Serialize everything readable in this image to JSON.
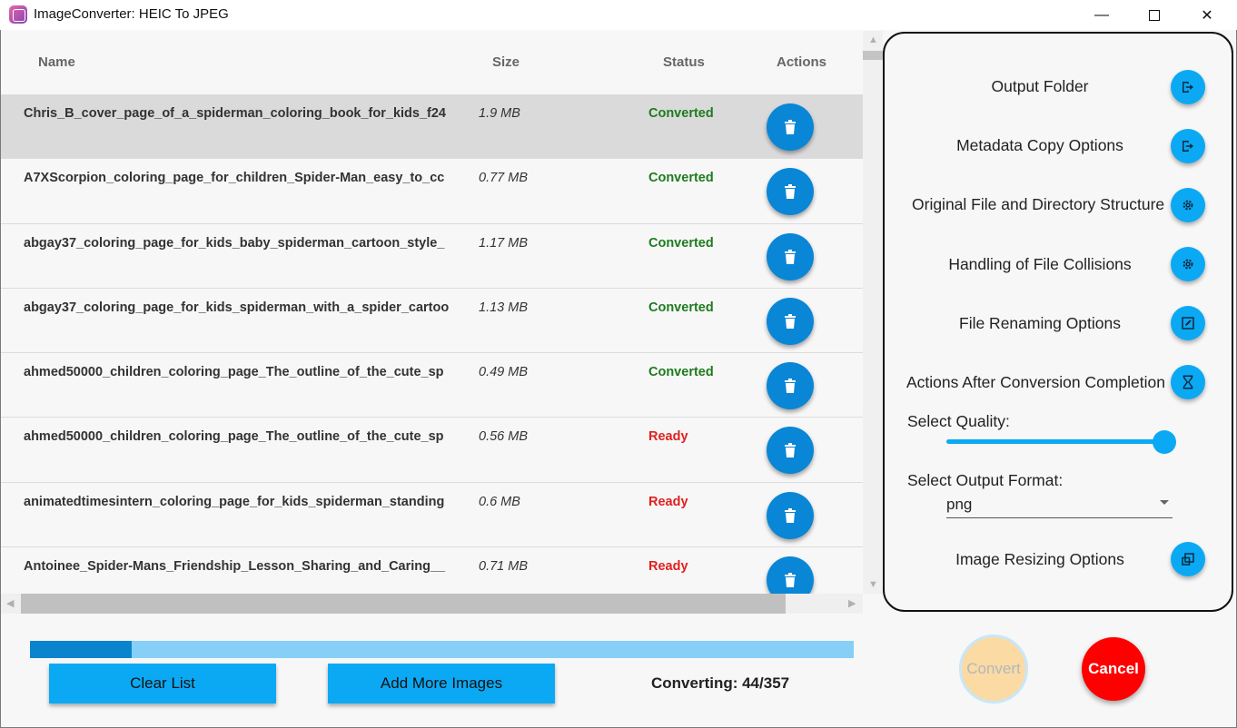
{
  "window": {
    "title": "ImageConverter: HEIC To JPEG",
    "minimize": "—",
    "close": "✕"
  },
  "table": {
    "headers": {
      "name": "Name",
      "size": "Size",
      "status": "Status",
      "actions": "Actions"
    },
    "rows": [
      {
        "name": "Chris_B_cover_page_of_a_spiderman_coloring_book_for_kids_f24",
        "size": "1.9 MB",
        "status": "Converted",
        "selected": true
      },
      {
        "name": "A7XScorpion_coloring_page_for_children_Spider-Man_easy_to_cc",
        "size": "0.77 MB",
        "status": "Converted"
      },
      {
        "name": "abgay37_coloring_page_for_kids_baby_spiderman_cartoon_style_",
        "size": "1.17 MB",
        "status": "Converted"
      },
      {
        "name": "abgay37_coloring_page_for_kids_spiderman_with_a_spider_cartoo",
        "size": "1.13 MB",
        "status": "Converted"
      },
      {
        "name": "ahmed50000_children_coloring_page_The_outline_of_the_cute_sp",
        "size": "0.49 MB",
        "status": "Converted"
      },
      {
        "name": "ahmed50000_children_coloring_page_The_outline_of_the_cute_sp",
        "size": "0.56 MB",
        "status": "Ready"
      },
      {
        "name": "animatedtimesintern_coloring_page_for_kids_spiderman_standing",
        "size": "0.6 MB",
        "status": "Ready"
      },
      {
        "name": "Antoinee_Spider-Mans_Friendship_Lesson_Sharing_and_Caring__",
        "size": "0.71 MB",
        "status": "Ready"
      }
    ]
  },
  "progress": {
    "fraction": 0.123
  },
  "buttons": {
    "clear": "Clear List",
    "add": "Add More Images",
    "convert": "Convert",
    "cancel": "Cancel"
  },
  "status_text": "Converting: 44/357",
  "options": {
    "output_folder": "Output Folder",
    "metadata": "Metadata Copy Options",
    "original_structure": "Original File and Directory Structure",
    "collisions": "Handling of File Collisions",
    "renaming": "File Renaming Options",
    "after_conversion": "Actions After Conversion Completion",
    "quality_label": "Select Quality:",
    "quality_value": 1.0,
    "format_label": "Select Output Format:",
    "format_value": "png",
    "resizing": "Image Resizing Options"
  },
  "colors": {
    "accent": "#0ba9f4",
    "delete_button": "#0a86d6",
    "converted": "#1e7b1e",
    "ready": "#e02020",
    "cancel": "#ff0000",
    "convert_disabled": "#fbdaa3"
  }
}
